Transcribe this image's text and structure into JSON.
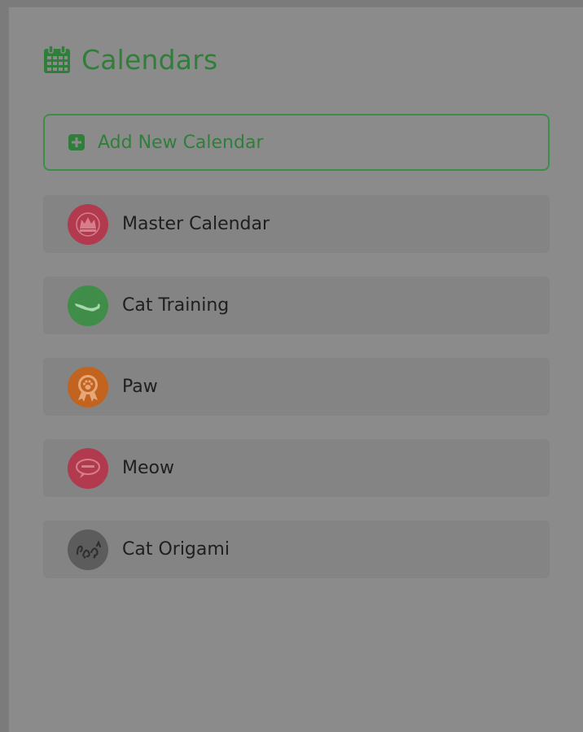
{
  "header": {
    "title": "Calendars",
    "icon": "calendar-icon",
    "accent_color": "#2f7e3a"
  },
  "add_button": {
    "label": "Add New Calendar",
    "icon": "plus-square-icon"
  },
  "calendars": [
    {
      "name": "Master Calendar",
      "icon": "crown-icon",
      "color": "#b23a4f"
    },
    {
      "name": "Cat Training",
      "icon": "cat-leap-icon",
      "color": "#3f8d48"
    },
    {
      "name": "Paw",
      "icon": "paw-badge-icon",
      "color": "#c26320"
    },
    {
      "name": "Meow",
      "icon": "speech-bubble-icon",
      "color": "#b23a4f"
    },
    {
      "name": "Cat Origami",
      "icon": "origami-icon",
      "color": "#5c5c5c"
    }
  ]
}
